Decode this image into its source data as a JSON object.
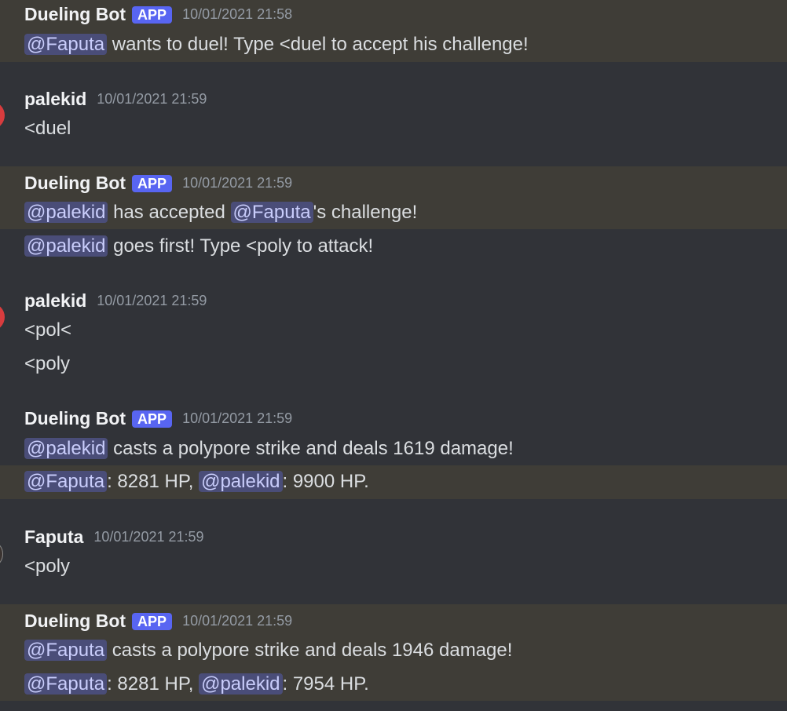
{
  "messages": {
    "m1": {
      "author": "Dueling Bot",
      "badge": "APP",
      "time": "10/01/2021 21:58",
      "l1": {
        "mention": "@Faputa",
        "text": " wants to duel! Type <duel to accept his challenge!"
      }
    },
    "m2": {
      "author": "palekid",
      "time": "10/01/2021 21:59",
      "l1": "<duel"
    },
    "m3": {
      "author": "Dueling Bot",
      "badge": "APP",
      "time": "10/01/2021 21:59",
      "l1": {
        "mention1": "@palekid",
        "text1": " has accepted ",
        "mention2": "@Faputa",
        "text2": "'s challenge!"
      },
      "l2": {
        "mention": "@palekid",
        "text": " goes first! Type <poly to attack!"
      }
    },
    "m4": {
      "author": "palekid",
      "time": "10/01/2021 21:59",
      "l1": "<pol<",
      "l2": "<poly"
    },
    "m5": {
      "author": "Dueling Bot",
      "badge": "APP",
      "time": "10/01/2021 21:59",
      "l1": {
        "mention": "@palekid",
        "text": " casts a polypore strike and deals 1619 damage!"
      },
      "l2": {
        "mention1": "@Faputa",
        "text1": ": 8281 HP, ",
        "mention2": "@palekid",
        "text2": ": 9900 HP."
      }
    },
    "m6": {
      "author": "Faputa",
      "time": "10/01/2021 21:59",
      "l1": "<poly"
    },
    "m7": {
      "author": "Dueling Bot",
      "badge": "APP",
      "time": "10/01/2021 21:59",
      "l1": {
        "mention": "@Faputa",
        "text": " casts a polypore strike and deals 1946 damage!"
      },
      "l2": {
        "mention1": "@Faputa",
        "text1": ": 8281 HP, ",
        "mention2": "@palekid",
        "text2": ": 7954 HP."
      }
    }
  },
  "colors": {
    "background": "#313338",
    "highlight": "#3f3d37",
    "mention_bg": "#4a4d78",
    "mention_text": "#c9cdfb",
    "app_badge": "#5865f2",
    "avatar_palekid": "#d83c3e"
  }
}
